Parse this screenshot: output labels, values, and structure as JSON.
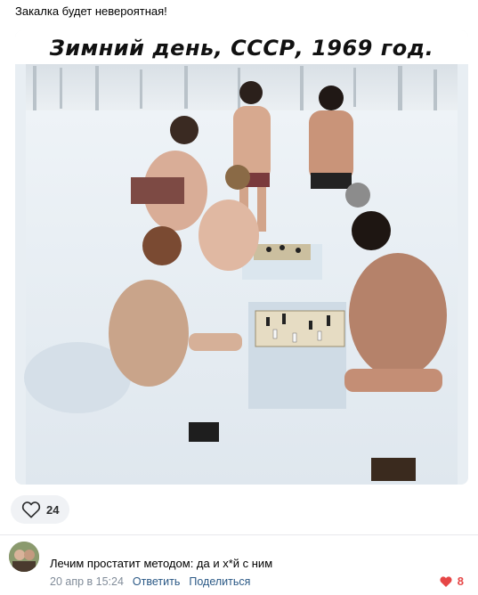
{
  "post": {
    "text": "Закалка будет невероятная!",
    "image_caption": "Зимний день, СССР, 1969 год.",
    "like_count": "24"
  },
  "comment": {
    "text": "Лечим простатит методом: да и х*й с ним",
    "date": "20 апр в 15:24",
    "reply_label": "Ответить",
    "share_label": "Поделиться",
    "like_count": "8"
  },
  "colors": {
    "link": "#2a5885",
    "meta": "#818c99",
    "heart_active": "#e64646",
    "like_bg": "#f0f2f5"
  }
}
